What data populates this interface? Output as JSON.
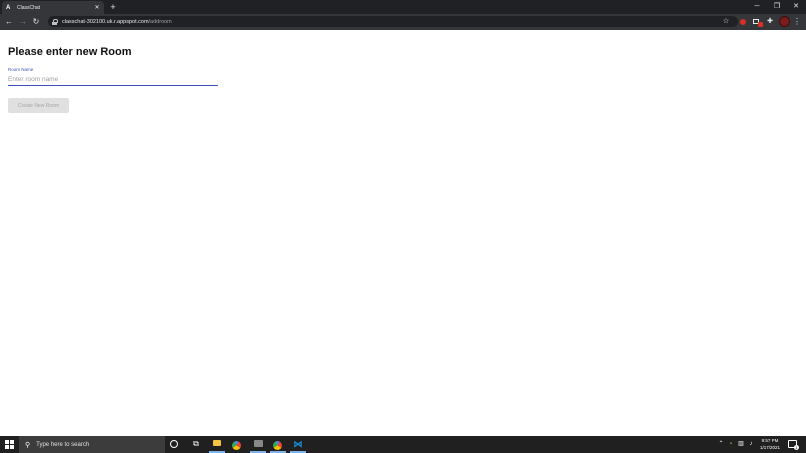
{
  "browser": {
    "tab_title": "ClassChat",
    "tab_favicon": "A",
    "url_host": "classchat-302100.uk.r.appspot.com",
    "url_path": "/addroom"
  },
  "page": {
    "heading": "Please enter new Room",
    "room_field_label": "Room Name",
    "room_field_placeholder": "Enter room name",
    "room_field_value": "",
    "create_button_label": "Create New Room"
  },
  "taskbar": {
    "search_placeholder": "Type here to search",
    "time": "9:57 PM",
    "date": "1/17/2021",
    "notification_count": "1"
  },
  "colors": {
    "accent": "#3f51b5",
    "chrome_dark": "#202124",
    "toolbar": "#35363a"
  }
}
